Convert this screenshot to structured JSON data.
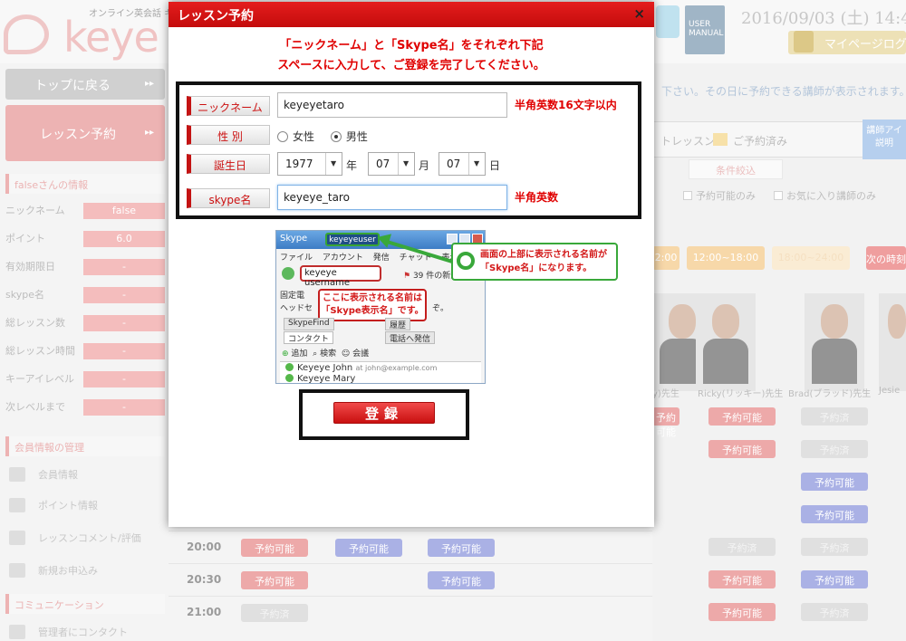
{
  "background": {
    "logo": {
      "tagline": "オンライン英会話 キー",
      "wordmark": "keye"
    },
    "topbar": {
      "date": "2016/09/03 (土) 14:4",
      "manual_label": "USER MANUAL",
      "logout_label": "マイページログア"
    },
    "sidebar": {
      "top_button": "トップに戻る",
      "lesson_button": "レッスン予約",
      "user_info_heading": "falseさんの情報",
      "rows": [
        {
          "label": "ニックネーム",
          "value": "false"
        },
        {
          "label": "ポイント",
          "value": "6.0"
        },
        {
          "label": "有効期限日",
          "value": "-"
        },
        {
          "label": "skype名",
          "value": "-"
        },
        {
          "label": "総レッスン数",
          "value": "-"
        },
        {
          "label": "総レッスン時間",
          "value": "-"
        },
        {
          "label": "キーアイレベル",
          "value": "-"
        },
        {
          "label": "次レベルまで",
          "value": "-"
        }
      ],
      "member_heading": "会員情報の管理",
      "links": [
        "会員情報",
        "ポイント情報",
        "レッスンコメント/評価",
        "新規お申込み"
      ],
      "comm_heading": "コミュニケーション",
      "contact_link": "管理者にコンタクト"
    },
    "content": {
      "info_text": "下さい。その日に予約できる講師が表示されます。",
      "legend_lesson": "トレッスン",
      "legend_booked": "ご予約済み",
      "teacher_icon_button": "講師アイ 説明",
      "filter_heading": "条件絞込",
      "checkboxes": [
        "予約可能のみ",
        "お気に入り講師のみ"
      ],
      "time_buttons": [
        "2:00",
        "12:00~18:00",
        "18:00~24:00",
        "次の時刻"
      ],
      "teacher_names": [
        "y)先生",
        "Ricky(リッキー)先生",
        "Brad(ブラッド)先生",
        "Jesie"
      ],
      "slot_available": "予約可能",
      "slot_booked": "予約済"
    },
    "grid_times": [
      "20:00",
      "20:30",
      "21:00"
    ]
  },
  "modal": {
    "title": "レッスン予約",
    "close_symbol": "×",
    "instruction_line1": "「ニックネーム」と「Skype名」をそれぞれ下記",
    "instruction_line2": "スペースに入力して、ご登録を完了してください。",
    "form": {
      "nickname_label": "ニックネーム",
      "nickname_value": "keyeyetaro",
      "nickname_note": "半角英数16文字以内",
      "gender_label": "性 別",
      "gender_female": "女性",
      "gender_male": "男性",
      "gender_selected": "男性",
      "birthday_label": "誕生日",
      "birth_year": "1977",
      "birth_month": "07",
      "birth_day": "07",
      "unit_year": "年",
      "unit_month": "月",
      "unit_day": "日",
      "skype_label": "skype名",
      "skype_value": "keyeye_taro",
      "skype_note": "半角英数"
    },
    "skype_example": {
      "app_name": "Skype",
      "display_name": "keyeyeuser",
      "menu": [
        "ファイル",
        "アカウント",
        "発信",
        "チャット",
        "表示",
        "ツ"
      ],
      "username": "keyeye username",
      "new_events": "39 件の新規",
      "line_landline": "固定電",
      "line_headset": "ヘッドセ",
      "line_tail": "ぞ。",
      "tip_line1": "ここに表示される名前は",
      "tip_line2": "「Skype表示名」です。",
      "tab_skypefind": "SkypeFind",
      "tab_history": "履歴",
      "tab_contacts": "コンタクト",
      "tab_call": "電話へ発信",
      "action_add": "追加",
      "action_search": "検索",
      "action_conference": "会議",
      "contacts": [
        {
          "name": "Keyeye John",
          "extra": "at john@example.com"
        },
        {
          "name": "Keyeye Mary",
          "extra": ""
        }
      ]
    },
    "callout_line1": "画面の上部に表示される名前が",
    "callout_line2": "「Skype名」になります。",
    "submit_label": "登録"
  },
  "colors": {
    "modal_header": "#d41414",
    "accent_red": "#e00000",
    "callout_green": "#39a83a",
    "slot_available": "#e47b7b",
    "slot_blue": "#7d88d8"
  }
}
